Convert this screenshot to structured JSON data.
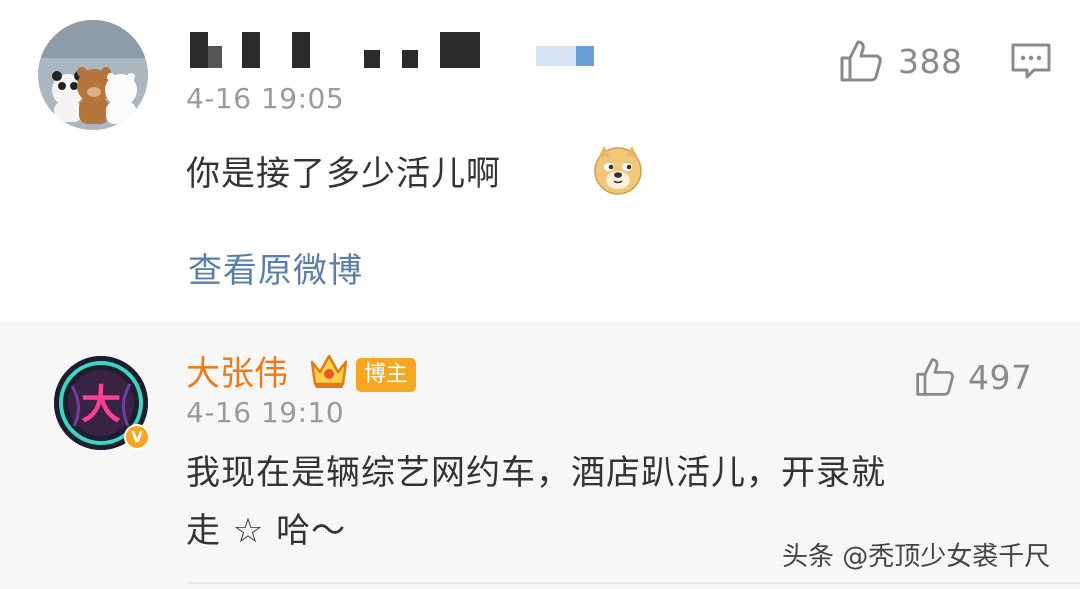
{
  "comments": [
    {
      "username": "",
      "time": "4-16 19:05",
      "text": "你是接了多少活儿啊",
      "emoji": "doge-emoji",
      "likes": "388",
      "view_original": "查看原微博"
    },
    {
      "username": "大张伟",
      "badge": "博主",
      "time": "4-16 19:10",
      "text_line1": "我现在是辆综艺网约车，酒店趴活儿，开录就",
      "text_line2": "走 ☆ 哈～",
      "likes": "497",
      "verified_mark": "V"
    }
  ],
  "watermark": "头条 @秃顶少女裘千尺",
  "colors": {
    "username": "#ef7a1a",
    "link": "#5b7fa8",
    "text": "#333333",
    "meta": "#9b9b9b",
    "badge": "#f5a623"
  }
}
